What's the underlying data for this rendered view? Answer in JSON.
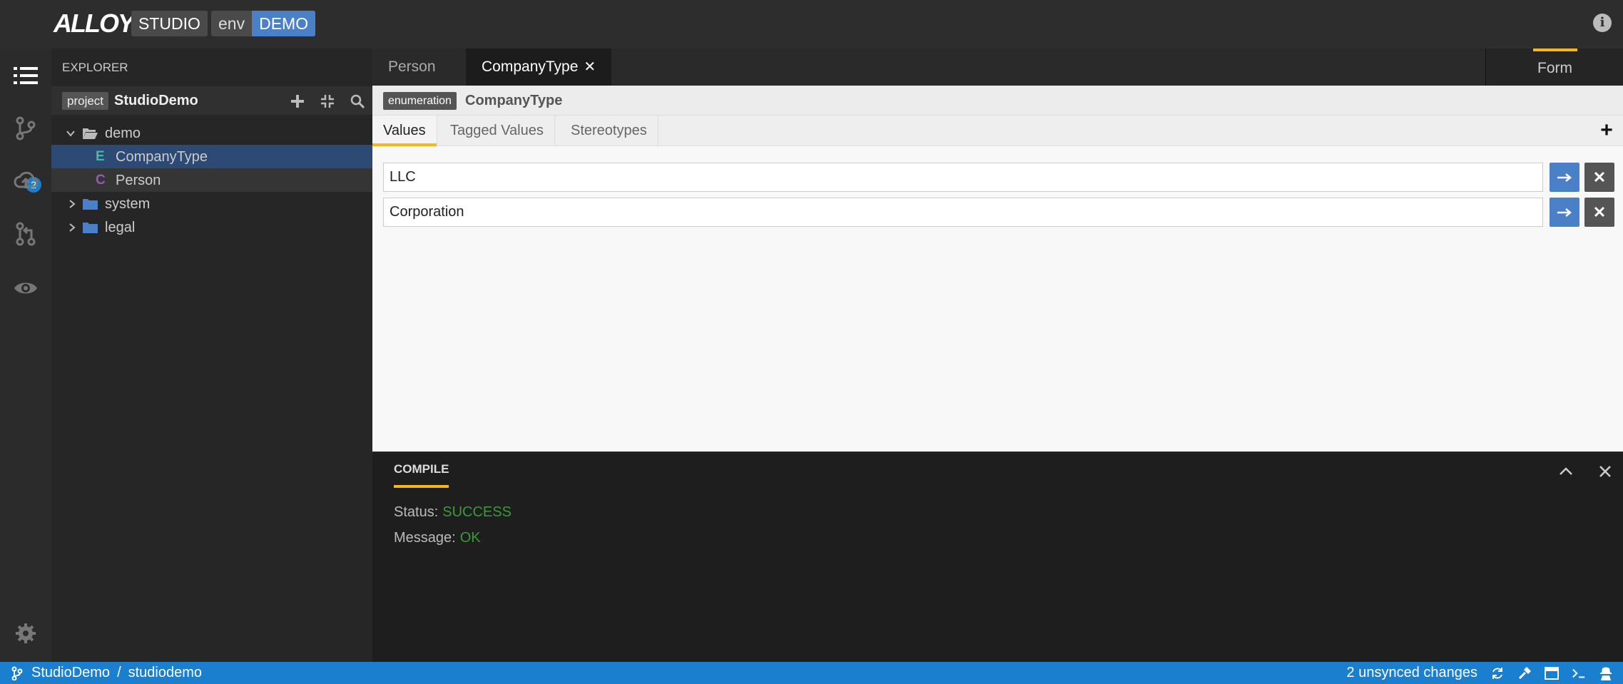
{
  "app": {
    "logo_text": "ALLOY",
    "studio_label": "STUDIO",
    "env_label": "env",
    "env_value": "DEMO"
  },
  "activity": {
    "branch_count": "2"
  },
  "explorer": {
    "title": "EXPLORER",
    "project_badge": "project",
    "project_name": "StudioDemo",
    "tree": [
      {
        "label": "demo",
        "kind": "folder",
        "expanded": true
      },
      {
        "label": "CompanyType",
        "kind": "enumeration",
        "letter": "E",
        "selected": true
      },
      {
        "label": "Person",
        "kind": "class",
        "letter": "C"
      },
      {
        "label": "system",
        "kind": "folder",
        "expanded": false
      },
      {
        "label": "legal",
        "kind": "folder",
        "expanded": false
      }
    ]
  },
  "tabs": [
    {
      "label": "Person",
      "active": false
    },
    {
      "label": "CompanyType",
      "active": true
    }
  ],
  "form_tab": "Form",
  "editor": {
    "element_badge": "enumeration",
    "element_name": "CompanyType",
    "subtabs": [
      "Values",
      "Tagged Values",
      "Stereotypes"
    ],
    "values": [
      "LLC",
      "Corporation"
    ]
  },
  "compile": {
    "title": "COMPILE",
    "status_label": "Status:",
    "status_value": "SUCCESS",
    "message_label": "Message:",
    "message_value": "OK"
  },
  "statusbar": {
    "project": "StudioDemo",
    "separator": "/",
    "workspace": "studiodemo",
    "changes": "2 unsynced changes"
  },
  "colors": {
    "accent": "#f3b820",
    "status_bar": "#1b7fd0",
    "selected_row": "#2c4a73",
    "success": "#3a9a3a",
    "enum_letter": "#3fbf9f",
    "class_letter": "#9b59b6"
  }
}
